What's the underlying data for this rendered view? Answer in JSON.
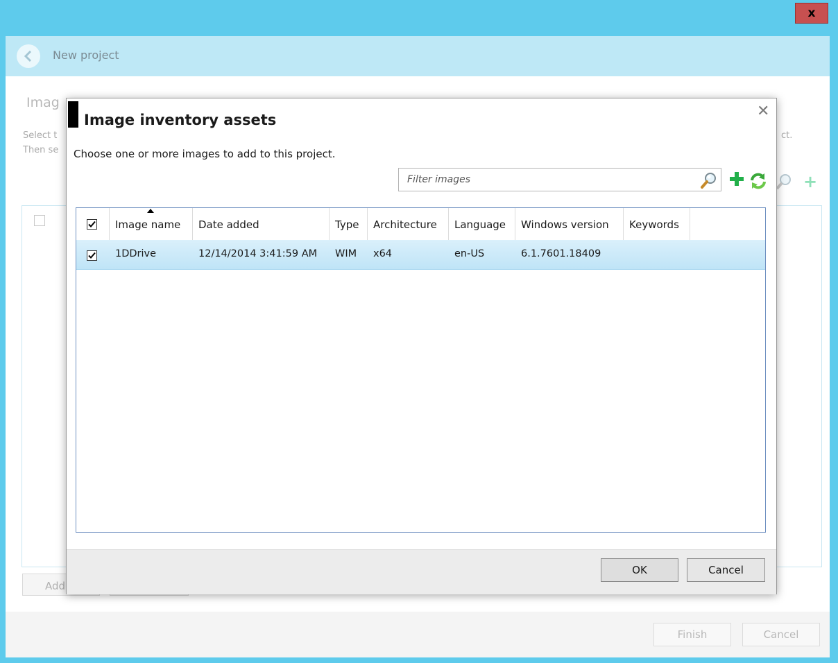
{
  "window": {
    "close_label": "x",
    "header_title": "New project",
    "bg_heading": "Imag",
    "bg_desc_line1": "Select t",
    "bg_desc_line2": "Then se",
    "bg_desc_tail": "ct.",
    "bg_add_button": "Add",
    "finish_label": "Finish",
    "cancel_label": "Cancel"
  },
  "dialog": {
    "title": "Image inventory assets",
    "close_glyph": "✕",
    "description": "Choose one or more images to add to this project.",
    "filter_placeholder": "Filter images",
    "ok_label": "OK",
    "cancel_label": "Cancel",
    "columns": [
      "Image name",
      "Date added",
      "Type",
      "Architecture",
      "Language",
      "Windows version",
      "Keywords"
    ],
    "header_checked": true,
    "sorted_column": "Image name",
    "rows": [
      {
        "selected": true,
        "checked": true,
        "image_name": "1DDrive",
        "date_added": "12/14/2014 3:41:59 AM",
        "type": "WIM",
        "architecture": "x64",
        "language": "en-US",
        "windows_version": "6.1.7601.18409",
        "keywords": ""
      }
    ]
  },
  "icons": {
    "back": "back-arrow-icon",
    "search": "magnifier-icon",
    "add": "green-plus-icon",
    "refresh": "green-refresh-icon"
  },
  "colors": {
    "title_bar": "#5ecbec",
    "header_band": "#bee8f6",
    "close_button": "#c75050",
    "selected_row": "#bfe4f7",
    "accent_green": "#22b04a"
  }
}
